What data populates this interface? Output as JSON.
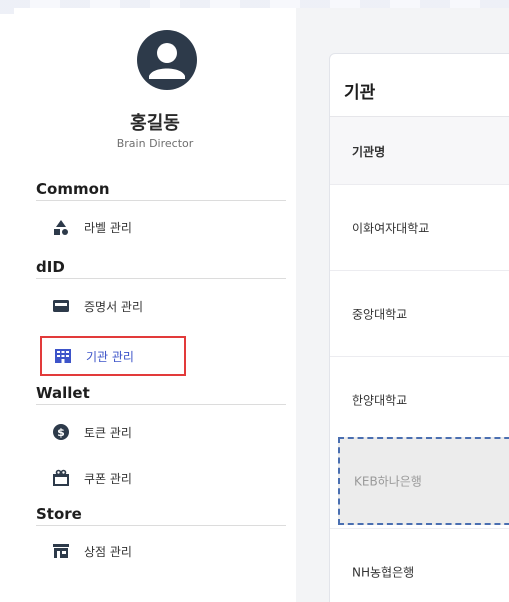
{
  "user": {
    "name": "홍길동",
    "role": "Brain Director"
  },
  "sidebar": {
    "sections": [
      {
        "title": "Common",
        "items": [
          {
            "label": "라벨 관리",
            "icon": "label-tag-icon"
          }
        ]
      },
      {
        "title": "dID",
        "items": [
          {
            "label": "증명서 관리",
            "icon": "certificate-card-icon"
          },
          {
            "label": "기관 관리",
            "icon": "building-icon",
            "active": true
          }
        ]
      },
      {
        "title": "Wallet",
        "items": [
          {
            "label": "토큰 관리",
            "icon": "dollar-coin-icon"
          },
          {
            "label": "쿠폰 관리",
            "icon": "gift-coupon-icon"
          }
        ]
      },
      {
        "title": "Store",
        "items": [
          {
            "label": "상점 관리",
            "icon": "store-icon"
          }
        ]
      }
    ]
  },
  "main": {
    "title": "기관",
    "column_header": "기관명",
    "rows": [
      {
        "name": "이화여자대학교"
      },
      {
        "name": "중앙대학교"
      },
      {
        "name": "한양대학교"
      },
      {
        "name": "KEB하나은행",
        "dragging": true
      },
      {
        "name": "NH농협은행"
      }
    ]
  },
  "colors": {
    "accent": "#3d54c9",
    "highlight_border": "#e23a3a",
    "drag_border": "#4a6fb1",
    "icon_dark": "#2d3a4a"
  }
}
